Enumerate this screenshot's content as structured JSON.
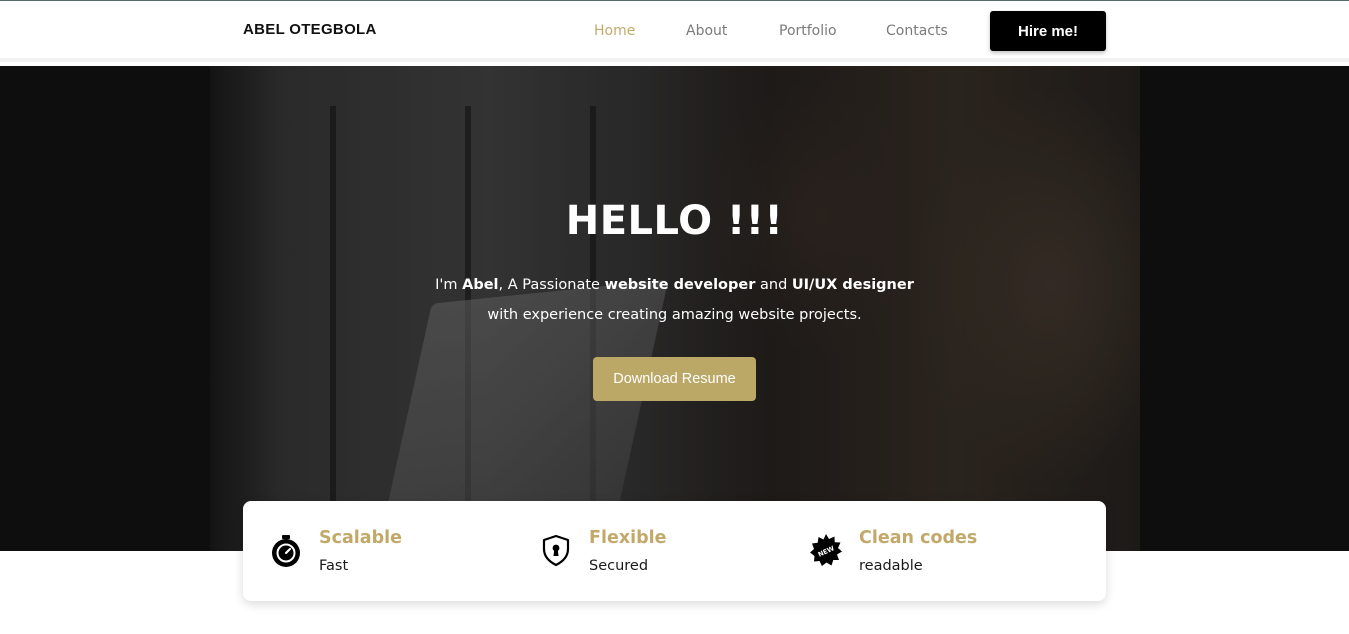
{
  "navbar": {
    "brand": "ABEL OTEGBOLA",
    "links": [
      "Home",
      "About",
      "Portfolio",
      "Contacts"
    ],
    "active_link": "Home",
    "hire_label": "Hire me!"
  },
  "hero": {
    "title": "HELLO !!!",
    "intro": {
      "p1": "I'm ",
      "name": "Abel",
      "p2": ", A Passionate ",
      "role1": "website developer",
      "p3": " and ",
      "role2": "UI/UX designer",
      "p4": " with experience creating amazing website projects."
    },
    "button_label": "Download Resume"
  },
  "features": [
    {
      "icon": "stopwatch-icon",
      "title": "Scalable",
      "subtitle": "Fast"
    },
    {
      "icon": "shield-keyhole-icon",
      "title": "Flexible",
      "subtitle": "Secured"
    },
    {
      "icon": "new-badge-icon",
      "badge_text": "NEW",
      "title": "Clean codes",
      "subtitle": "readable"
    }
  ],
  "colors": {
    "accent": "#c2a96a",
    "button": "#bba766",
    "hire_button": "#000000"
  }
}
